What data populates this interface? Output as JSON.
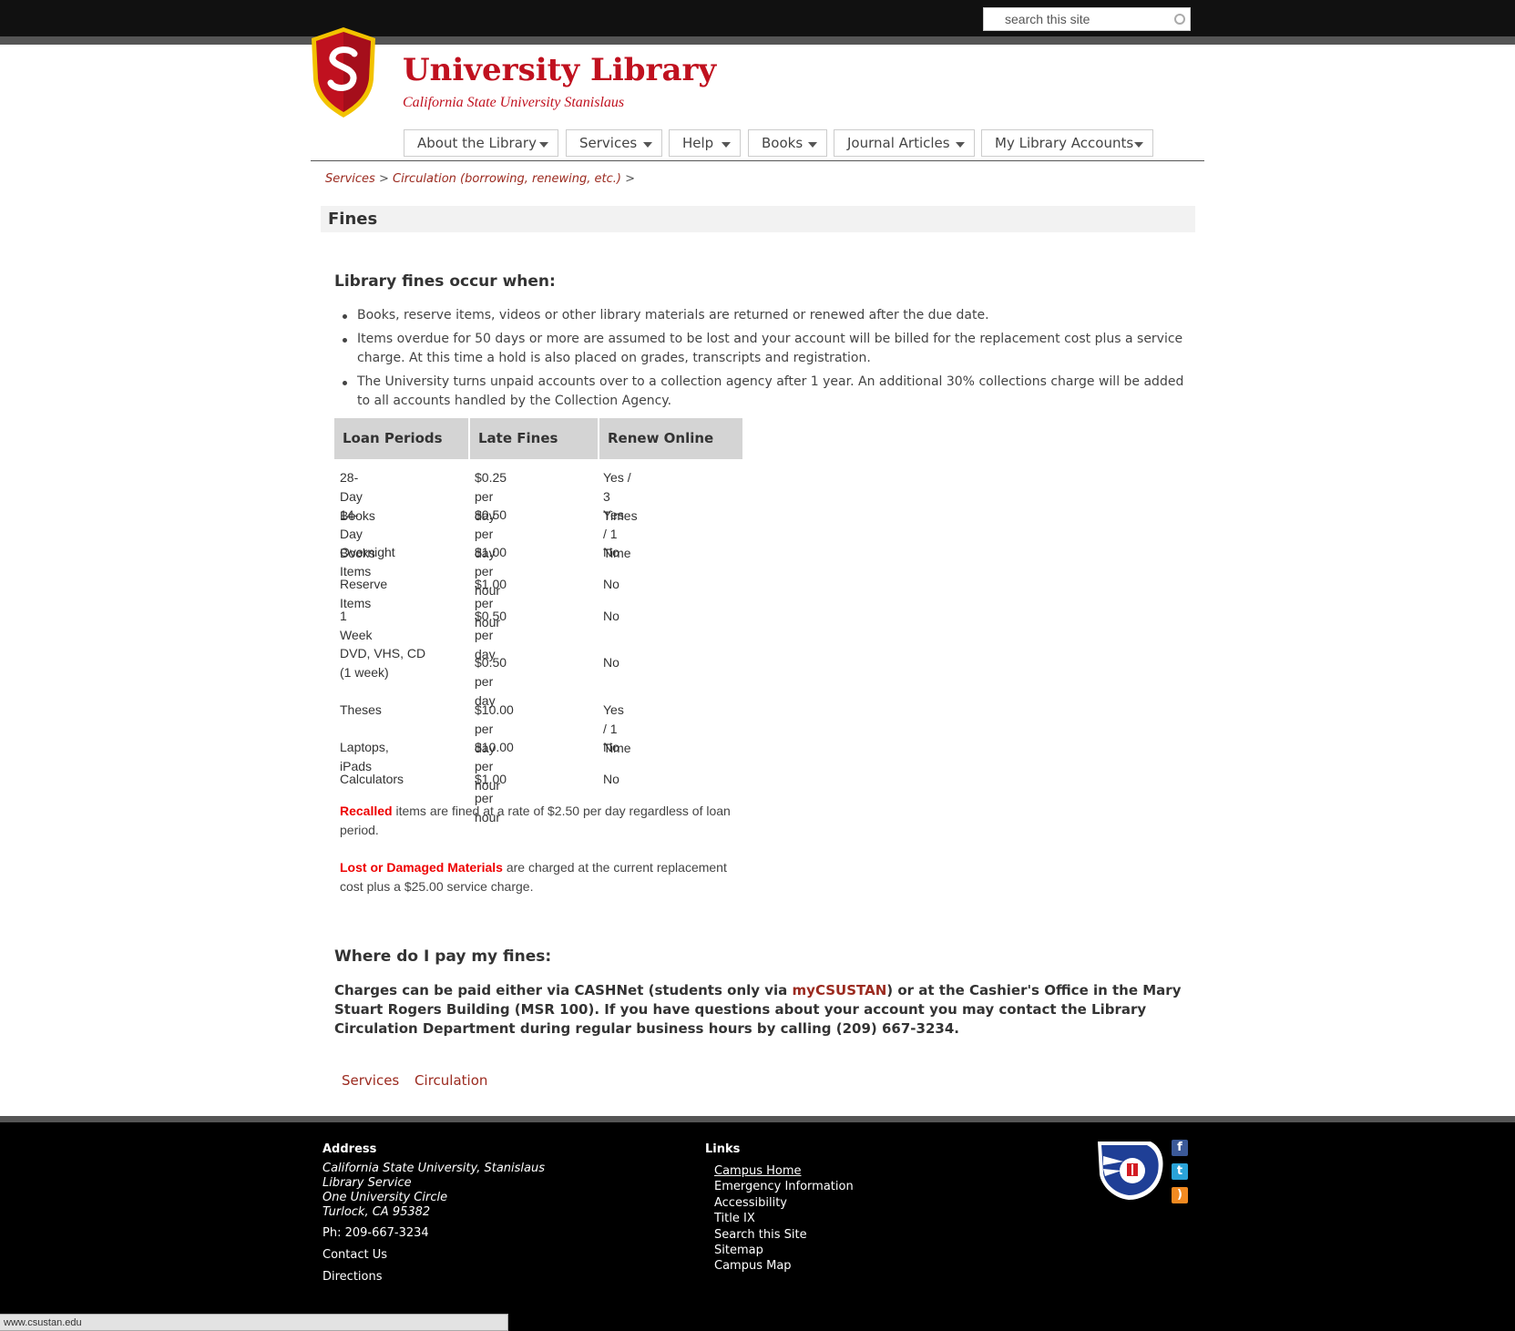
{
  "search": {
    "placeholder": "search this site"
  },
  "header": {
    "title": "University Library",
    "subtitle": "California State University Stanislaus"
  },
  "nav": [
    {
      "label": "About the Library"
    },
    {
      "label": "Services"
    },
    {
      "label": "Help"
    },
    {
      "label": "Books"
    },
    {
      "label": "Journal Articles"
    },
    {
      "label": "My Library Accounts"
    }
  ],
  "breadcrumb": {
    "item1": "Services",
    "sep": ">",
    "item2": "Circulation (borrowing, renewing, etc.)"
  },
  "page": {
    "title": "Fines"
  },
  "section1": {
    "heading": "Library fines occur when:",
    "bullets": [
      "Books, reserve items, videos or other library materials are returned or renewed after the due date.",
      "Items overdue for 50 days or more are assumed to be lost and your account will be billed for the replacement cost plus a service charge.  At this time a hold is also placed on grades, transcripts and registration.",
      "The University turns unpaid accounts over to a collection agency after 1 year.  An additional 30% collections charge will be added to all accounts handled by the Collection Agency."
    ]
  },
  "table": {
    "headers": [
      "Loan Periods",
      "Late Fines",
      "Renew Online"
    ],
    "rows": [
      [
        "28-Day Books",
        "$0.25 per day",
        "Yes / 3 Times"
      ],
      [
        "14-Day Books",
        "$0.50 per day",
        "Yes / 1 Time"
      ],
      [
        "Overnight Items",
        "$1.00 per hour",
        "No"
      ],
      [
        "Reserve Items",
        "$1.00 per hour",
        "No"
      ],
      [
        "1 Week",
        "$0.50 per day",
        "No"
      ],
      [
        "DVD, VHS, CD (1 week)",
        "$0.50 per day",
        "No"
      ],
      [
        "Theses",
        "$10.00 per day",
        "Yes / 1 Time"
      ],
      [
        "Laptops, iPads",
        "$10.00 per hour",
        "No"
      ],
      [
        "Calculators",
        "$1.00 per hour",
        "No"
      ]
    ]
  },
  "notes": {
    "recalled_label": "Recalled",
    "recalled_text": " items are fined at a rate of $2.50 per day regardless of loan period.",
    "lost_label": "Lost or Damaged Materials",
    "lost_text": " are charged at the current replacement cost plus a $25.00 service charge."
  },
  "section2": {
    "heading": "Where do I pay my fines:",
    "text_a": "Charges can be paid either via CASHNet (students only via ",
    "link": "myCSUSTAN",
    "text_b": ") or at the Cashier's Office in the Mary Stuart Rogers Building (MSR 100).  If you have questions about your account you may contact the Library Circulation Department during regular business hours by calling  (209) 667-3234."
  },
  "tags": [
    "Services",
    "Circulation"
  ],
  "footer": {
    "address_heading": "Address",
    "address_lines": [
      "California State University, Stanislaus",
      "Library Service",
      "One University Circle",
      "Turlock, CA 95382"
    ],
    "phone_label": "Ph:",
    "phone": "209-667-3234",
    "contact": "Contact Us",
    "directions": "Directions",
    "links_heading": "Links",
    "links": [
      "Campus Home",
      "Emergency Information",
      "Accessibility",
      "Title IX",
      "Search this Site",
      "Sitemap",
      "Campus Map"
    ]
  },
  "status_bar": "www.csustan.edu",
  "colors": {
    "brand_red": "#c0111f",
    "link": "#9b2a1f",
    "alert_red": "#e00000"
  }
}
